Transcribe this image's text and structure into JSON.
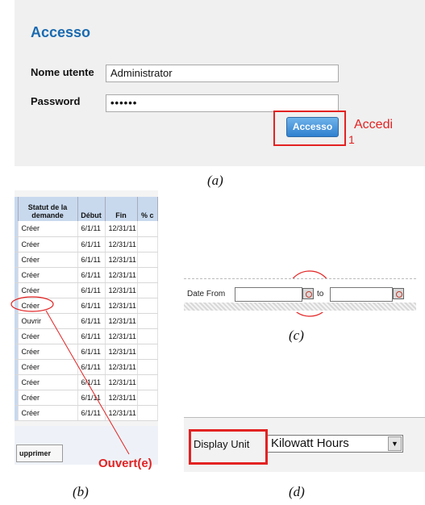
{
  "panel_a": {
    "title": "Accesso",
    "username_label": "Nome utente",
    "username_value": "Administrator",
    "password_label": "Password",
    "password_value": "••••••",
    "login_button": "Accesso",
    "annotation_text": "Accedi",
    "annotation_number": "1",
    "caption": "(a)"
  },
  "panel_b": {
    "columns": [
      "Statut de la demande",
      "Début",
      "Fin",
      "% c"
    ],
    "rows": [
      {
        "status": "Créer",
        "start": "6/1/11",
        "end": "12/31/11"
      },
      {
        "status": "Créer",
        "start": "6/1/11",
        "end": "12/31/11"
      },
      {
        "status": "Créer",
        "start": "6/1/11",
        "end": "12/31/11"
      },
      {
        "status": "Créer",
        "start": "6/1/11",
        "end": "12/31/11"
      },
      {
        "status": "Créer",
        "start": "6/1/11",
        "end": "12/31/11"
      },
      {
        "status": "Créer",
        "start": "6/1/11",
        "end": "12/31/11"
      },
      {
        "status": "Ouvrir",
        "start": "6/1/11",
        "end": "12/31/11"
      },
      {
        "status": "Créer",
        "start": "6/1/11",
        "end": "12/31/11"
      },
      {
        "status": "Créer",
        "start": "6/1/11",
        "end": "12/31/11"
      },
      {
        "status": "Créer",
        "start": "6/1/11",
        "end": "12/31/11"
      },
      {
        "status": "Créer",
        "start": "6/1/11",
        "end": "12/31/11"
      },
      {
        "status": "Créer",
        "start": "6/1/11",
        "end": "12/31/11"
      },
      {
        "status": "Créer",
        "start": "6/1/11",
        "end": "12/31/11"
      }
    ],
    "delete_button": "upprimer",
    "annotation_text": "Ouvert(e)",
    "caption": "(b)"
  },
  "panel_c": {
    "date_from_label": "Date From",
    "to_label": "to",
    "caption": "(c)"
  },
  "panel_d": {
    "display_unit_label": "Display Unit",
    "selected_unit": "Kilowatt Hours",
    "caption": "(d)"
  },
  "colors": {
    "annotation_red": "#e32222",
    "title_blue": "#1a6ab0",
    "button_blue": "#2f80cf",
    "header_blue": "#c8d9ee"
  },
  "icons": [
    "calendar-icon",
    "dropdown-arrow-icon"
  ]
}
